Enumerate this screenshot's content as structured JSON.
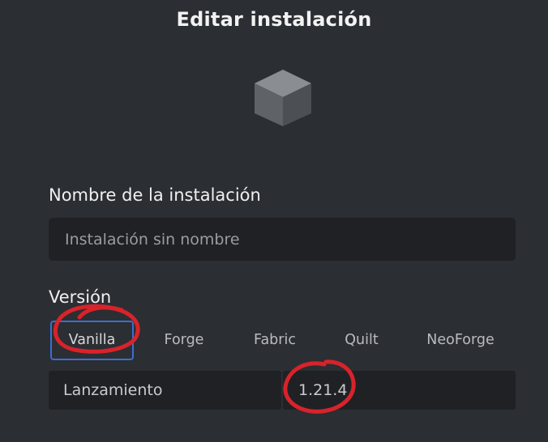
{
  "title": "Editar instalación",
  "icon": "cube-icon",
  "name_field": {
    "label": "Nombre de la instalación",
    "value": "",
    "placeholder": "Instalación sin nombre"
  },
  "version": {
    "label": "Versión",
    "tabs": [
      {
        "label": "Vanilla",
        "active": true
      },
      {
        "label": "Forge",
        "active": false
      },
      {
        "label": "Fabric",
        "active": false
      },
      {
        "label": "Quilt",
        "active": false
      },
      {
        "label": "NeoForge",
        "active": false
      }
    ],
    "type_value": "Lanzamiento",
    "number_value": "1.21.4"
  },
  "colors": {
    "background": "#2b2e33",
    "input_background": "#1f2125",
    "active_tab_border": "#3b6ed1",
    "annotation": "#d8232a"
  }
}
